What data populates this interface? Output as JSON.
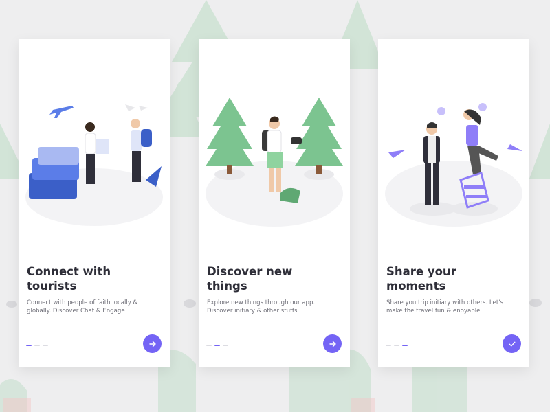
{
  "colors": {
    "accent": "#7464f5",
    "title": "#2e2e38",
    "text": "#6f6f78",
    "tree": "#7cc490",
    "tree_dark": "#5fa873",
    "background": "#eeeeef"
  },
  "screens": [
    {
      "title_line1": "Connect with",
      "title_line2": "tourists",
      "desc_line1": "Connect with people of faith locally &",
      "desc_line2": "globally. Discover Chat & Engage",
      "active_dot": 1,
      "button_icon": "arrow-right-icon"
    },
    {
      "title_line1": "Discover new",
      "title_line2": "things",
      "desc_line1": "Explore new things through our app.",
      "desc_line2": "Discover initiary & other stuffs",
      "active_dot": 2,
      "button_icon": "arrow-right-icon"
    },
    {
      "title_line1": "Share your",
      "title_line2": "moments",
      "desc_line1": "Share you trip initiary with others. Let's",
      "desc_line2": "make the travel fun & enoyable",
      "active_dot": 3,
      "button_icon": "checkmark-icon"
    }
  ]
}
